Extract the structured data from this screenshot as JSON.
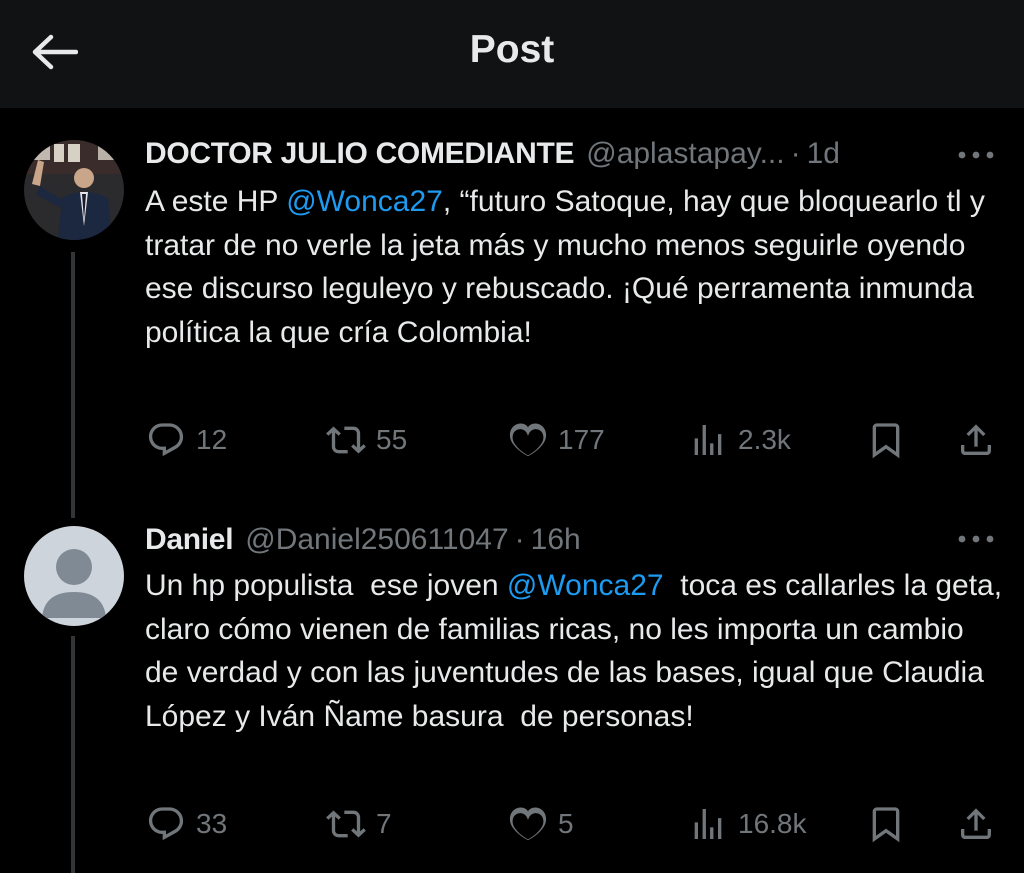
{
  "header": {
    "title": "Post",
    "back_icon": "arrow-left-icon"
  },
  "colors": {
    "background": "#000000",
    "header_bg": "#111214",
    "text": "#e7e9ea",
    "secondary": "#71767b",
    "mention": "#1d9bf0",
    "thread_line": "#333639"
  },
  "posts": [
    {
      "author": "DOCTOR JULIO COMEDIANTE",
      "handle": "@aplastapay...",
      "separator": "·",
      "time": "1d",
      "text_before": "A este HP ",
      "mention": "@Wonca27",
      "text_after": ", “futuro Satoque, hay que bloquearlo tl y tratar de no verle la jeta más y mucho menos seguirle oyendo ese discurso leguleyo y rebuscado. ¡Qué perramenta inmunda política la que cría Colombia!",
      "replies": "12",
      "reposts": "55",
      "likes": "177",
      "views": "2.3k"
    },
    {
      "author": "Daniel",
      "handle": "@Daniel250611047",
      "separator": "·",
      "time": "16h",
      "text_before": "Un hp populista  ese joven ",
      "mention": "@Wonca27",
      "text_after": "  toca es callarles la geta, claro cómo vienen de familias ricas, no les importa un cambio de verdad y con las juventudes de las bases, igual que Claudia López y Iván Ñame basura  de personas!",
      "replies": "33",
      "reposts": "7",
      "likes": "5",
      "views": "16.8k"
    }
  ]
}
